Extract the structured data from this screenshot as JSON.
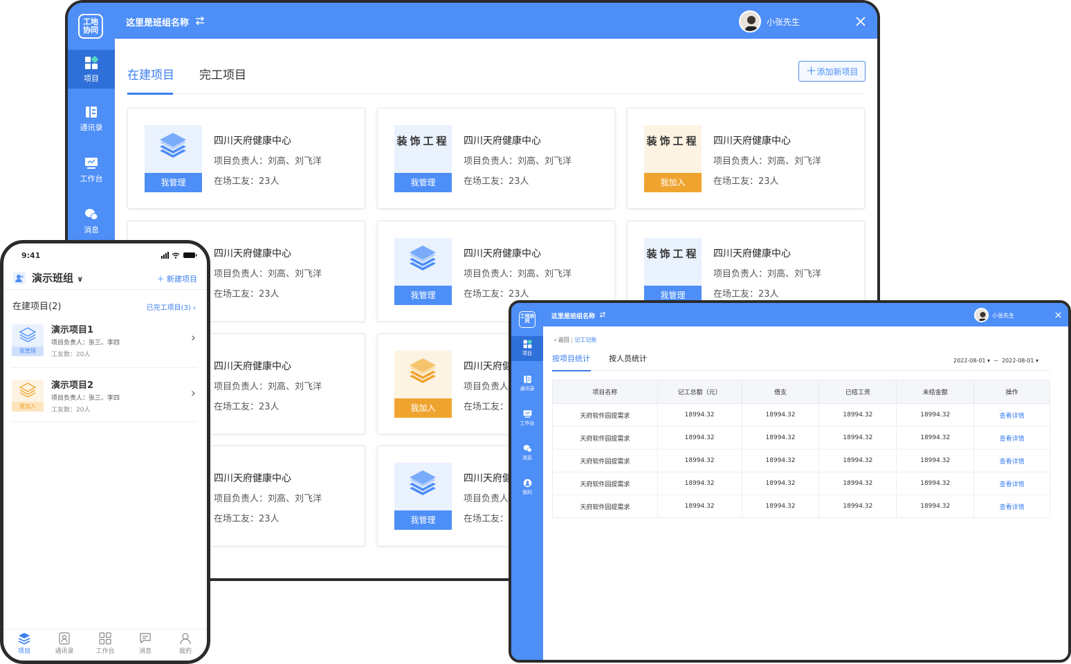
{
  "main": {
    "logo_text": "工地协同",
    "group_name": "这里是班组名称",
    "swap_icon": "swap-arrows-icon",
    "username": "小张先生",
    "close_icon": "close-icon",
    "sidebar": [
      {
        "label": "项目",
        "icon": "grid-icon"
      },
      {
        "label": "通讯录",
        "icon": "contacts-icon"
      },
      {
        "label": "工作台",
        "icon": "workbench-icon"
      },
      {
        "label": "消息",
        "icon": "chat-icon"
      }
    ],
    "tabs": [
      "在建项目",
      "完工项目"
    ],
    "add_button": "添加新项目",
    "cards": [
      {
        "thumb": "layers",
        "thumb_text": "",
        "button": "我管理",
        "title": "四川天府健康中心",
        "manager": "项目负责人：刘高、刘飞洋",
        "workers": "在场工友：23人"
      },
      {
        "thumb": "text",
        "thumb_text": "装饰工程",
        "button": "我管理",
        "title": "四川天府健康中心",
        "manager": "项目负责人：刘高、刘飞洋",
        "workers": "在场工友：23人"
      },
      {
        "thumb": "text-orange",
        "thumb_text": "装饰工程",
        "button": "我加入",
        "title": "四川天府健康中心",
        "manager": "项目负责人：刘高、刘飞洋",
        "workers": "在场工友：23人"
      },
      {
        "thumb": "hidden",
        "thumb_text": "",
        "button": "",
        "title": "四川天府健康中心",
        "manager": "项目负责人：刘高、刘飞洋",
        "workers": "在场工友：23人"
      },
      {
        "thumb": "layers",
        "thumb_text": "",
        "button": "我管理",
        "title": "四川天府健康中心",
        "manager": "项目负责人：刘高、刘飞洋",
        "workers": "在场工友：23人"
      },
      {
        "thumb": "text",
        "thumb_text": "装饰工程",
        "button": "我管理",
        "title": "四川天府健康中心",
        "manager": "项目负责人：刘高、刘飞洋",
        "workers": "在场工友：23人"
      },
      {
        "thumb": "hidden",
        "thumb_text": "",
        "button": "",
        "title": "四川天府健康中心",
        "manager": "项目负责人：刘高、刘飞洋",
        "workers": "在场工友：23人"
      },
      {
        "thumb": "layers-orange",
        "thumb_text": "",
        "button": "我加入",
        "title": "四川天府健康",
        "manager": "项目负责人：",
        "workers": "在场工友：2"
      },
      {
        "thumb": "hidden",
        "thumb_text": "",
        "button": "",
        "title": "四川天府健康中心",
        "manager": "项目负责人：刘高、刘飞洋",
        "workers": "在场工友：23人"
      },
      {
        "thumb": "layers",
        "thumb_text": "",
        "button": "我管理",
        "title": "四川天府健康",
        "manager": "项目负责人：",
        "workers": "在场工友：2"
      }
    ]
  },
  "stats": {
    "logo_text": "工地协同",
    "group_name": "这里是班组名称",
    "username": "小张先生",
    "sidebar": [
      {
        "label": "项目",
        "icon": "grid-icon"
      },
      {
        "label": "通讯录",
        "icon": "contacts-icon"
      },
      {
        "label": "工作台",
        "icon": "workbench-icon"
      },
      {
        "label": "消息",
        "icon": "chat-icon"
      },
      {
        "label": "我的",
        "icon": "user-icon"
      }
    ],
    "breadcrumb_back": "返回",
    "breadcrumb_sep": "|",
    "breadcrumb_current": "记工记账",
    "tabs": [
      "按项目统计",
      "按人员统计"
    ],
    "date_from": "2022-08-01",
    "date_sep": "~",
    "date_to": "2022-08-01",
    "columns": [
      "项目名称",
      "记工总额（元）",
      "借支",
      "已结工资",
      "未结金额",
      "操作"
    ],
    "rows": [
      [
        "天府软件园提需求",
        "18994.32",
        "18994.32",
        "18994.32",
        "18994.32",
        "查看详情"
      ],
      [
        "天府软件园提需求",
        "18994.32",
        "18994.32",
        "18994.32",
        "18994.32",
        "查看详情"
      ],
      [
        "天府软件园提需求",
        "18994.32",
        "18994.32",
        "18994.32",
        "18994.32",
        "查看详情"
      ],
      [
        "天府软件园提需求",
        "18994.32",
        "18994.32",
        "18994.32",
        "18994.32",
        "查看详情"
      ],
      [
        "天府软件园提需求",
        "18994.32",
        "18994.32",
        "18994.32",
        "18994.32",
        "查看详情"
      ]
    ]
  },
  "phone": {
    "time": "9:41",
    "group": "演示班组",
    "new_project": "新建项目",
    "section": "在建项目(2)",
    "finished_link": "已完工项目(3)",
    "items": [
      {
        "title": "演示项目1",
        "manager": "项目负责人：张三、李四",
        "workers": "工友数：20人",
        "badge": "我管理",
        "color": "blue"
      },
      {
        "title": "演示项目2",
        "manager": "项目负责人：张三、李四",
        "workers": "工友数：20人",
        "badge": "我加入",
        "color": "orange"
      }
    ],
    "nav": [
      {
        "label": "项目",
        "icon": "layers-icon"
      },
      {
        "label": "通讯录",
        "icon": "contacts-icon"
      },
      {
        "label": "工作台",
        "icon": "grid-icon"
      },
      {
        "label": "消息",
        "icon": "chat-icon"
      },
      {
        "label": "我的",
        "icon": "user-icon"
      }
    ]
  }
}
